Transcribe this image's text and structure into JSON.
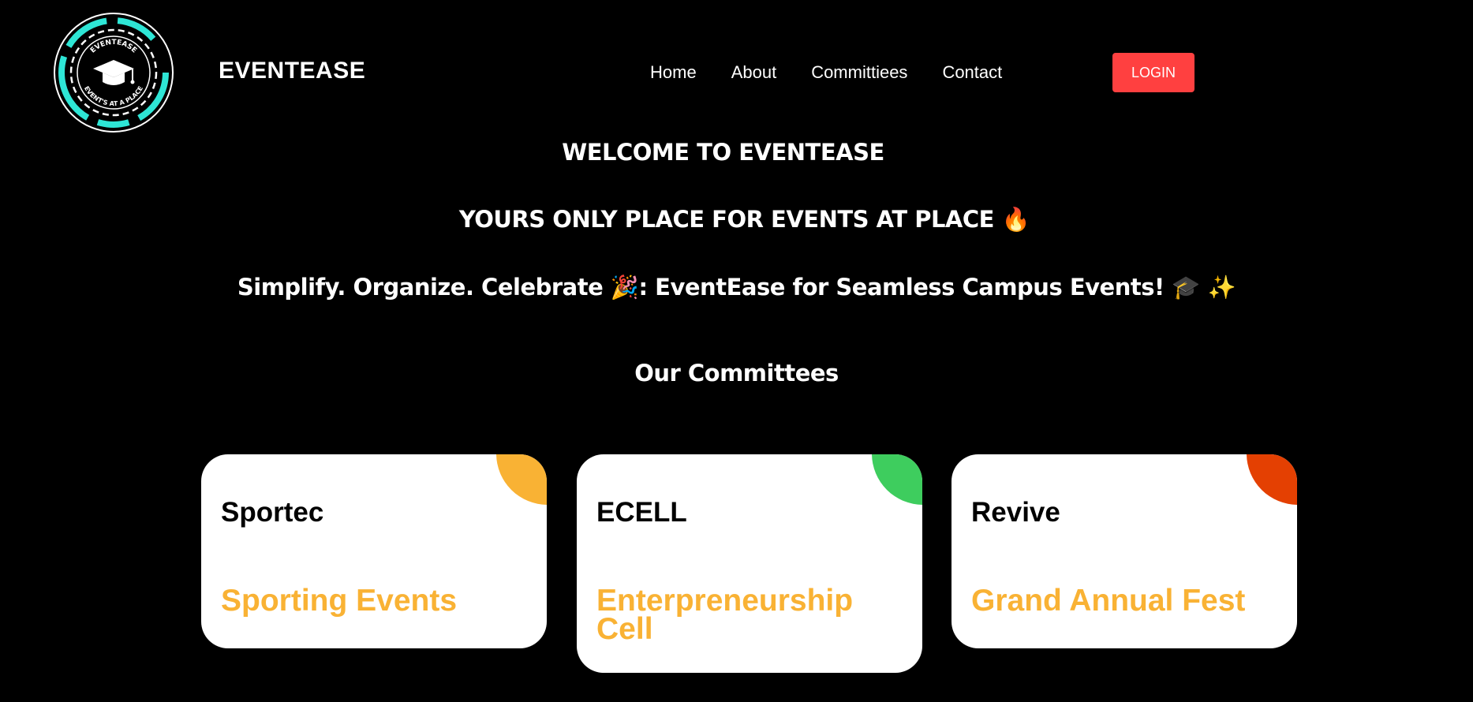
{
  "header": {
    "brand": "EVENTEASE",
    "logo": {
      "top_text": "EVENTEASE",
      "bottom_text": "EVENT'S AT A PLACE",
      "icon": "graduation-cap-icon"
    },
    "nav": [
      {
        "label": "Home"
      },
      {
        "label": "About"
      },
      {
        "label": "Committiees"
      },
      {
        "label": "Contact"
      }
    ],
    "login_label": "LOGIN"
  },
  "hero": {
    "line1": "WELCOME TO EVENTEASE",
    "line2": "YOURS ONLY PLACE FOR EVENTS AT PLACE 🔥",
    "line3": "Simplify. Organize. Celebrate 🎉: EventEase for Seamless Campus Events! 🎓 ✨"
  },
  "committees": {
    "title": "Our Committees",
    "cards": [
      {
        "title": "Sportec",
        "subtitle": "Sporting Events",
        "corner_color": "#f9b234"
      },
      {
        "title": "ECELL",
        "subtitle": "Enterpreneurship Cell",
        "corner_color": "#3ecd5e"
      },
      {
        "title": "Revive",
        "subtitle": "Grand Annual Fest",
        "corner_color": "#e44002"
      }
    ]
  },
  "colors": {
    "background": "#000000",
    "accent_login": "#ff4040",
    "logo_accent": "#2ee6d6",
    "card_subtitle": "#f9b234"
  }
}
